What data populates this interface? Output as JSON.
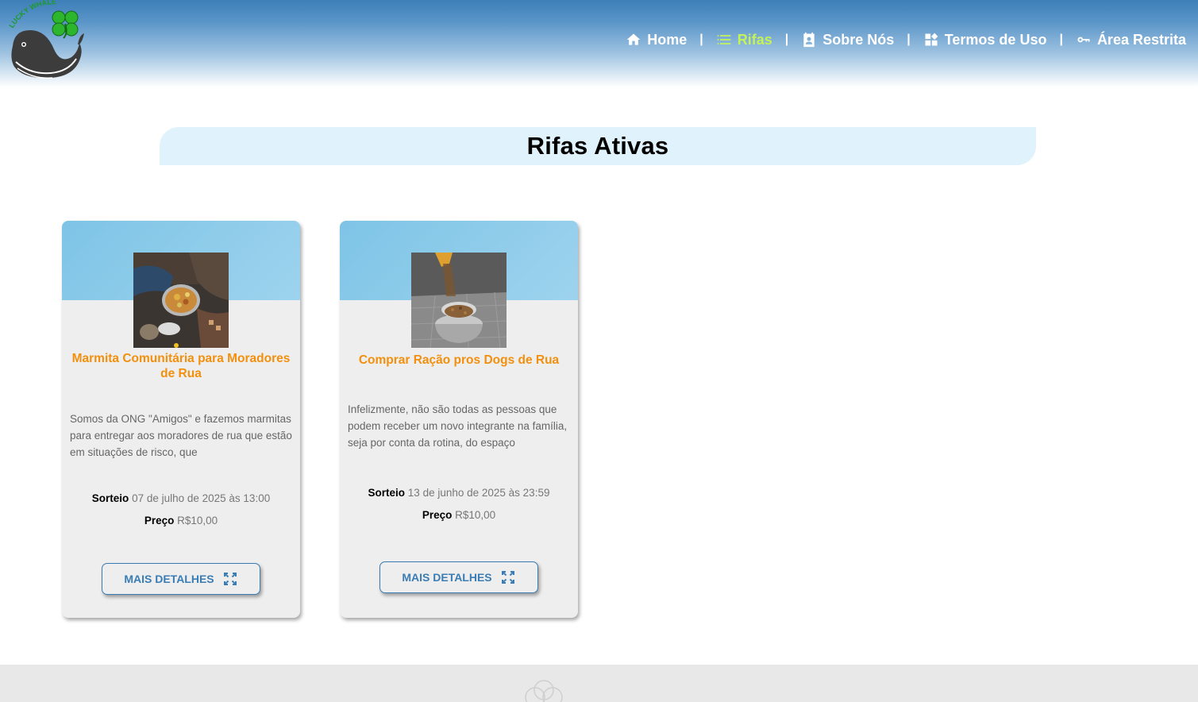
{
  "header": {
    "logo_alt": "Lucky Whale",
    "logo_text": "LUCKY WHALE",
    "nav": [
      {
        "label": "Home",
        "icon": "home-icon",
        "active": false
      },
      {
        "label": "Rifas",
        "icon": "list-icon",
        "active": true
      },
      {
        "label": "Sobre Nós",
        "icon": "contact-card-icon",
        "active": false
      },
      {
        "label": "Termos de Uso",
        "icon": "dashboard-icon",
        "active": false
      },
      {
        "label": "Área Restrita",
        "icon": "key-icon",
        "active": false
      }
    ],
    "separator": "|"
  },
  "main": {
    "title": "Rifas Ativas",
    "cards": [
      {
        "title": "Marmita Comunitária para Moradores de Rua",
        "image": "homeless-meal-photo",
        "description": "Somos da ONG \"Amigos\" e fazemos marmitas para entregar aos moradores de rua que estão em situações de risco, que",
        "draw_label": "Sorteio",
        "draw_value": "07 de julho de 2025 às 13:00",
        "price_label": "Preço",
        "price_value": "R$10,00",
        "button_label": "MAIS DETALHES",
        "button_icon": "fullscreen-icon"
      },
      {
        "title": "Comprar Ração pros Dogs de Rua",
        "image": "dog-food-bowl-photo",
        "description": "Infelizmente, não são todas as pessoas que podem receber um novo integrante na família, seja por conta da rotina, do espaço",
        "draw_label": "Sorteio",
        "draw_value": "13 de junho de 2025 às 23:59",
        "price_label": "Preço",
        "price_value": "R$10,00",
        "button_label": "MAIS DETALHES",
        "button_icon": "fullscreen-icon"
      }
    ]
  },
  "colors": {
    "header_top": "#3d7fb8",
    "nav_text": "#ffffff",
    "nav_active": "#c4f25a",
    "title_band": "#e0f2fb",
    "card_title": "#f2900e",
    "button_accent": "#3a7db5",
    "card_band": "#8ccbeb",
    "footer_bg": "#e8e8e8"
  }
}
